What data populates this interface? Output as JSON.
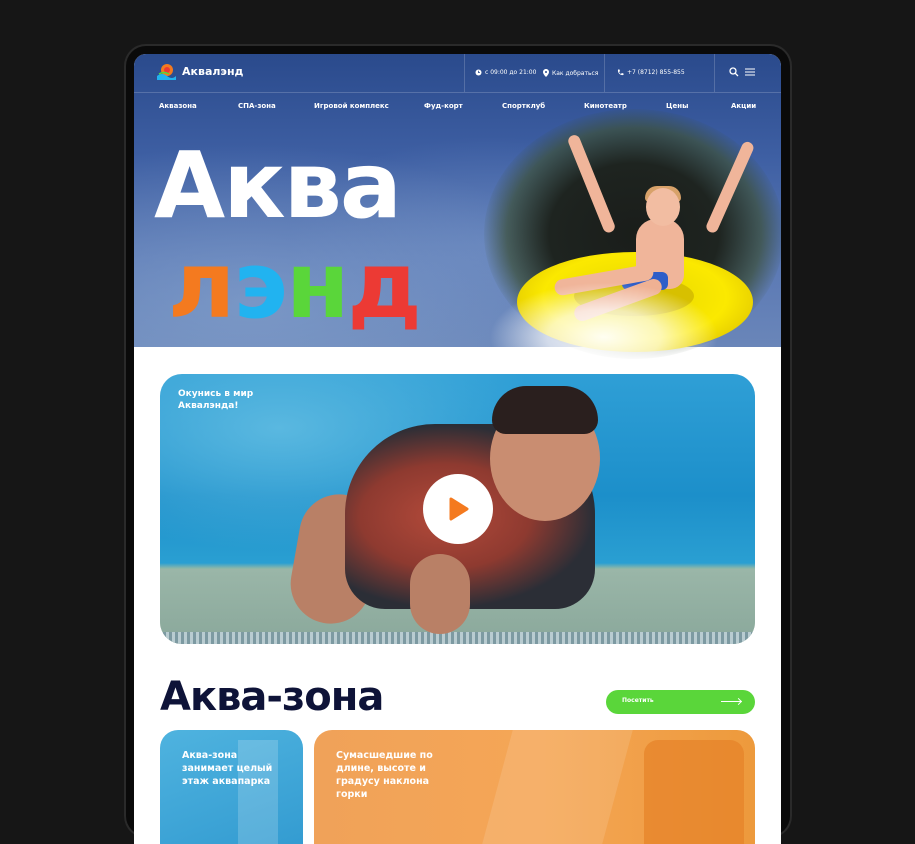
{
  "brand": {
    "name": "Аквалэнд"
  },
  "topbar": {
    "hours": "с 09:00 до 21:00",
    "directions": "Как добраться",
    "phone": "+7 (8712) 855-855"
  },
  "nav": {
    "items": [
      {
        "label": "Аквазона"
      },
      {
        "label": "СПА-зона"
      },
      {
        "label": "Игровой комплекс"
      },
      {
        "label": "Фуд-корт"
      },
      {
        "label": "Спортклуб"
      },
      {
        "label": "Кинотеатр"
      },
      {
        "label": "Цены"
      },
      {
        "label": "Акции"
      }
    ]
  },
  "hero": {
    "line1": "Аква",
    "line2_letters": [
      "л",
      "э",
      "н",
      "д"
    ],
    "line2_colors": [
      "#f47a1f",
      "#21b3f0",
      "#5ad63a",
      "#ec3a34"
    ]
  },
  "video": {
    "caption": "Окунись в мир Аквалэнда!"
  },
  "section": {
    "title": "Аква-зона",
    "visit_label": "Посетить"
  },
  "cards": [
    {
      "text": "Аква-зона занимает целый этаж аквапарка"
    },
    {
      "text": "Сумасшедшие по длине, высоте и градусу наклона горки"
    }
  ],
  "colors": {
    "accent_green": "#5ad63a",
    "play_orange": "#f47a1f",
    "title_navy": "#0e1338"
  }
}
